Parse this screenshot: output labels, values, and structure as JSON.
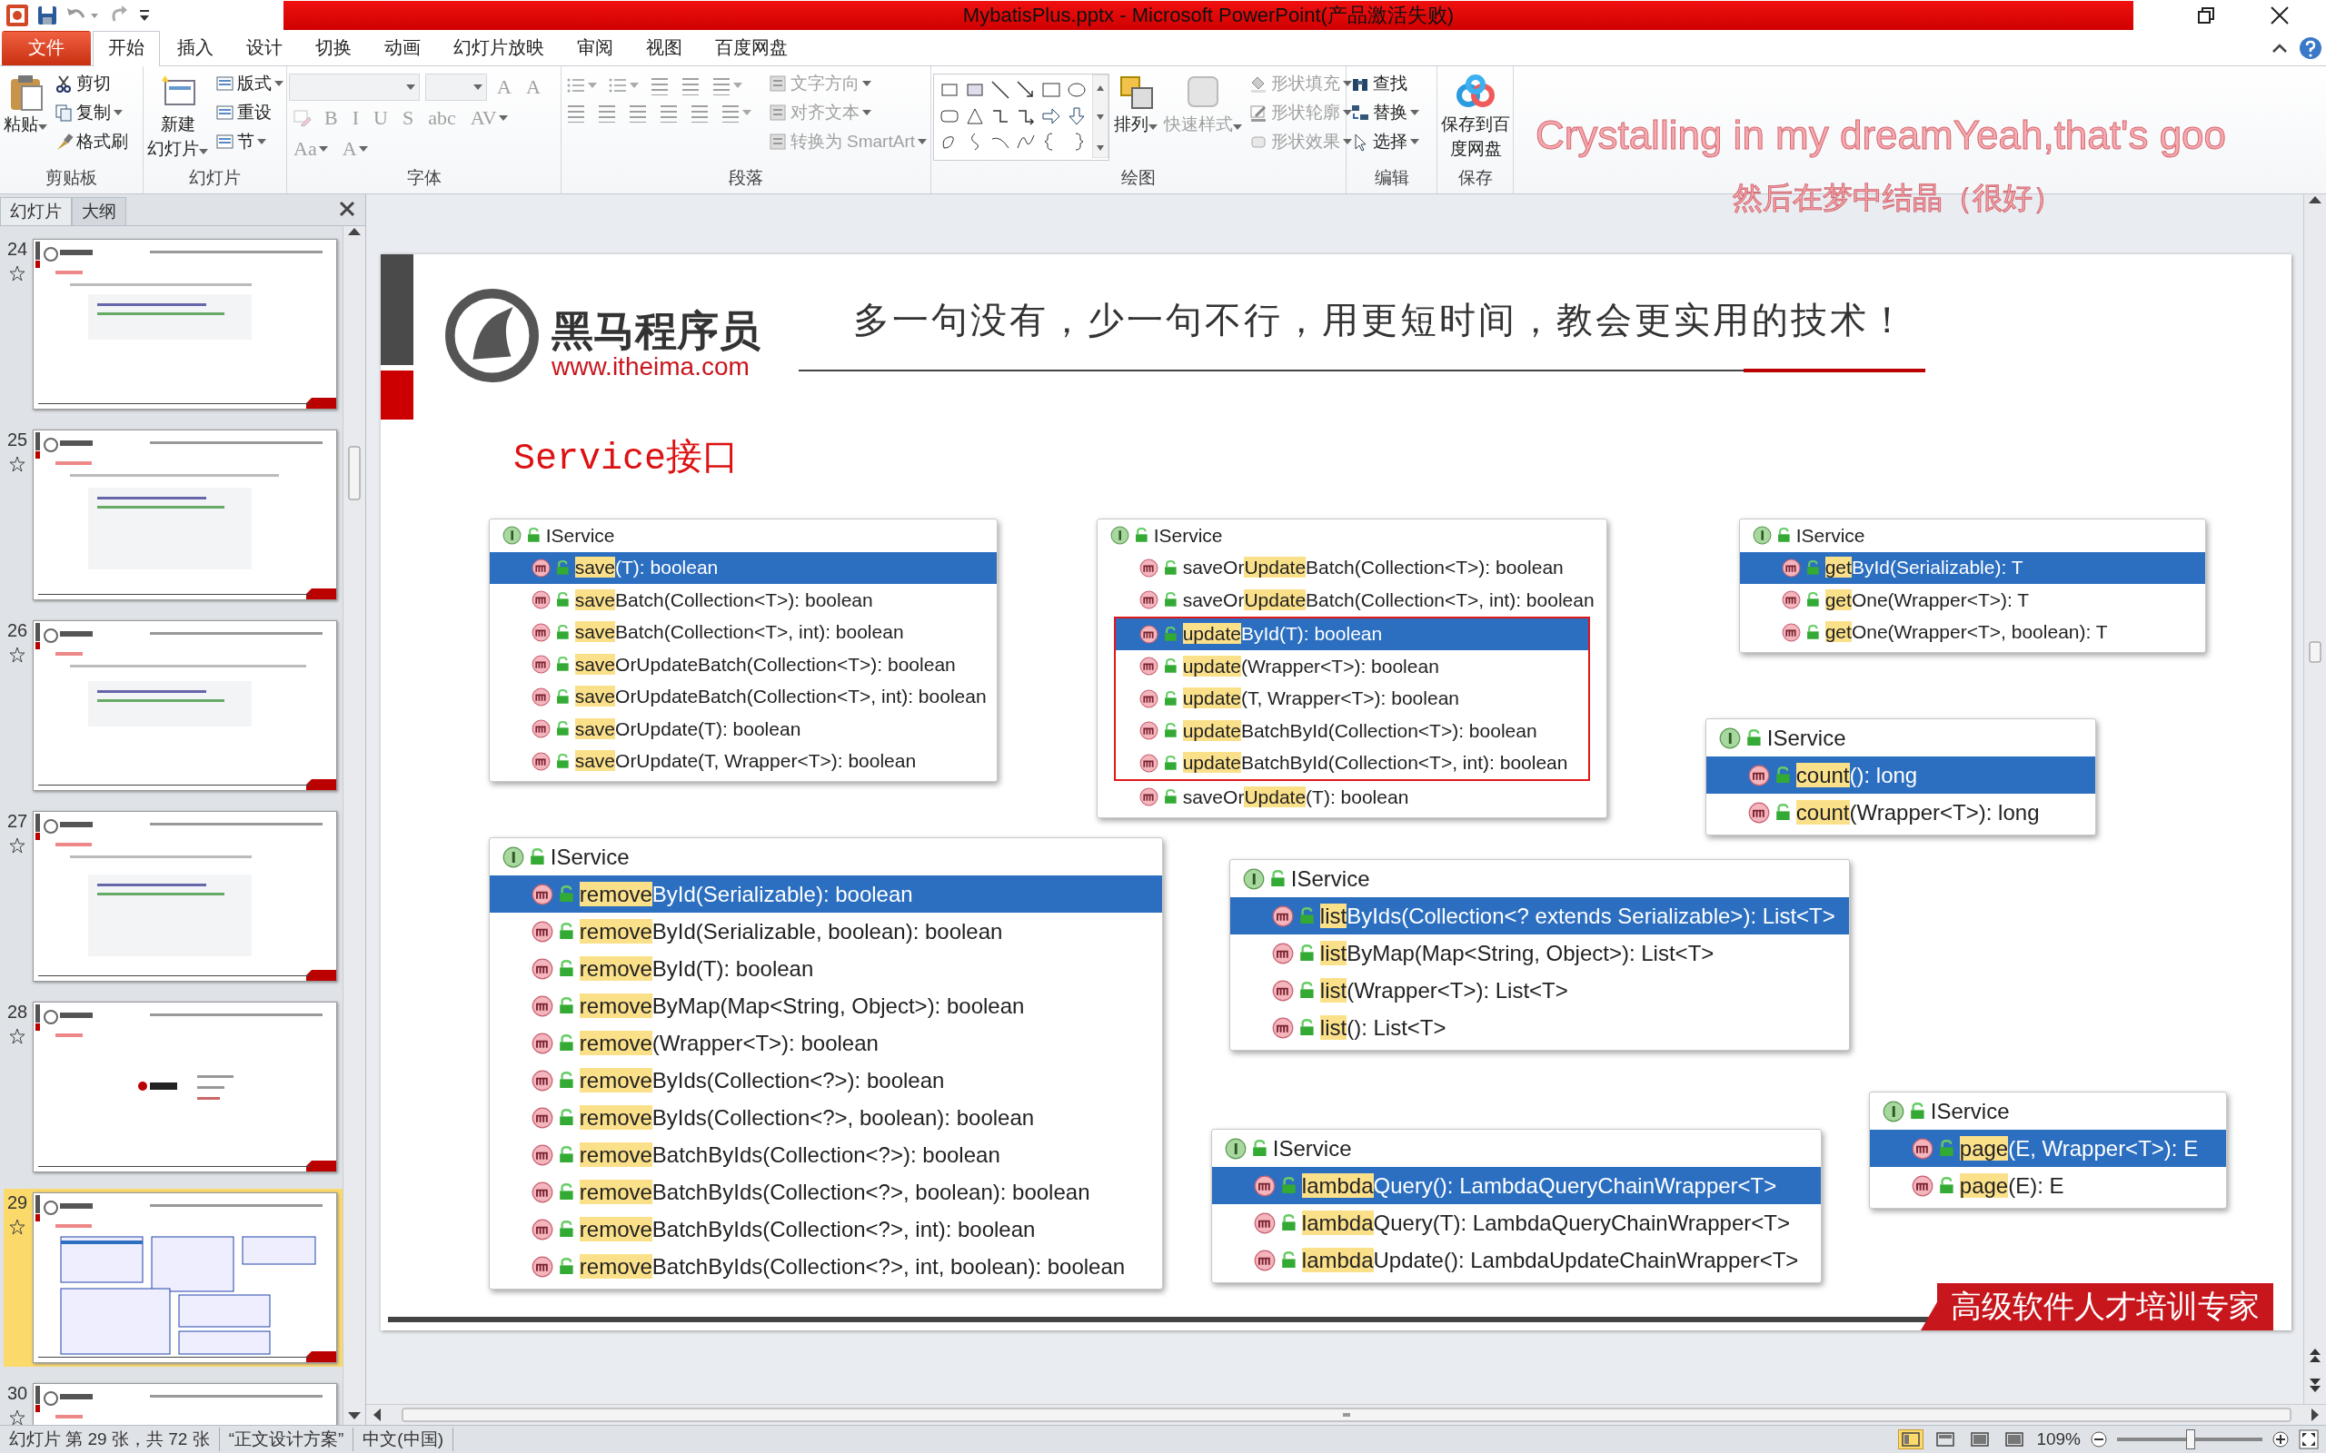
{
  "title_bar": {
    "title": "MybatisPlus.pptx - Microsoft PowerPoint(产品激活失败)"
  },
  "ribbon_tabs": [
    {
      "label": "文件",
      "kind": "file",
      "selected": false
    },
    {
      "label": "开始",
      "kind": "tab",
      "selected": true
    },
    {
      "label": "插入",
      "kind": "tab",
      "selected": false
    },
    {
      "label": "设计",
      "kind": "tab",
      "selected": false
    },
    {
      "label": "切换",
      "kind": "tab",
      "selected": false
    },
    {
      "label": "动画",
      "kind": "tab",
      "selected": false
    },
    {
      "label": "幻灯片放映",
      "kind": "tab",
      "selected": false
    },
    {
      "label": "审阅",
      "kind": "tab",
      "selected": false
    },
    {
      "label": "视图",
      "kind": "tab",
      "selected": false
    },
    {
      "label": "百度网盘",
      "kind": "tab",
      "selected": false
    }
  ],
  "ribbon_groups": [
    {
      "label": "剪贴板",
      "sections": [
        [
          {
            "kind": "large",
            "lines": [
              "粘贴"
            ],
            "dropdown": true,
            "disabled": false
          }
        ],
        [
          {
            "kind": "small",
            "label": "剪切",
            "dropdown": false,
            "disabled": false
          },
          {
            "kind": "small",
            "label": "复制",
            "dropdown": true,
            "disabled": false
          },
          {
            "kind": "small",
            "label": "格式刷",
            "dropdown": false,
            "disabled": false
          }
        ]
      ]
    },
    {
      "label": "幻灯片",
      "sections": [
        [
          {
            "kind": "large",
            "lines": [
              "新建",
              "幻灯片"
            ],
            "dropdown": true,
            "disabled": false
          }
        ],
        [
          {
            "kind": "small",
            "label": "版式",
            "dropdown": true,
            "disabled": false
          },
          {
            "kind": "small",
            "label": "重设",
            "dropdown": false,
            "disabled": false
          },
          {
            "kind": "small",
            "label": "节",
            "dropdown": true,
            "disabled": false
          }
        ]
      ]
    },
    {
      "label": "字体",
      "sections": [
        [
          {
            "kind": "combo",
            "dropdown": true,
            "disabled": true
          },
          {
            "kind": "combo",
            "dropdown": true,
            "disabled": true
          },
          {
            "kind": "letter",
            "label": "A",
            "dropdown": false,
            "disabled": true
          },
          {
            "kind": "letter",
            "label": "A",
            "dropdown": false,
            "disabled": true
          },
          {
            "kind": "icon",
            "dropdown": false,
            "disabled": true
          },
          {
            "kind": "letter",
            "label": "B",
            "dropdown": false,
            "disabled": true
          },
          {
            "kind": "letter",
            "label": "I",
            "dropdown": false,
            "disabled": true
          },
          {
            "kind": "letter",
            "label": "U",
            "dropdown": false,
            "disabled": true
          },
          {
            "kind": "letter",
            "label": "S",
            "dropdown": false,
            "disabled": true
          },
          {
            "kind": "letter",
            "label": "abc",
            "dropdown": false,
            "disabled": true
          },
          {
            "kind": "letter",
            "label": "AV",
            "dropdown": true,
            "disabled": true
          },
          {
            "kind": "letter",
            "label": "Aa",
            "dropdown": true,
            "disabled": true
          },
          {
            "kind": "letter",
            "label": "A",
            "dropdown": true,
            "disabled": true
          }
        ]
      ]
    },
    {
      "label": "段落",
      "sections": [
        [
          {
            "kind": "icon",
            "dropdown": true,
            "disabled": true
          },
          {
            "kind": "icon",
            "dropdown": true,
            "disabled": true
          },
          {
            "kind": "icon",
            "dropdown": false,
            "disabled": true
          },
          {
            "kind": "icon",
            "dropdown": false,
            "disabled": true
          },
          {
            "kind": "icon",
            "dropdown": true,
            "disabled": true
          },
          {
            "kind": "icon",
            "dropdown": false,
            "disabled": true
          },
          {
            "kind": "icon",
            "dropdown": false,
            "disabled": true
          },
          {
            "kind": "icon",
            "dropdown": false,
            "disabled": true
          },
          {
            "kind": "icon",
            "dropdown": false,
            "disabled": true
          },
          {
            "kind": "icon",
            "dropdown": false,
            "disabled": true
          },
          {
            "kind": "icon",
            "dropdown": true,
            "disabled": true
          }
        ],
        [
          {
            "kind": "small",
            "label": "文字方向",
            "dropdown": true,
            "disabled": true
          },
          {
            "kind": "small",
            "label": "对齐文本",
            "dropdown": true,
            "disabled": true
          },
          {
            "kind": "small",
            "label": "转换为 SmartArt",
            "dropdown": true,
            "disabled": true
          }
        ]
      ]
    },
    {
      "label": "绘图",
      "sections": [
        [
          {
            "kind": "gallery",
            "dropdown": false,
            "disabled": false
          }
        ],
        [
          {
            "kind": "large",
            "lines": [
              "排列"
            ],
            "dropdown": true,
            "disabled": false
          }
        ],
        [
          {
            "kind": "large",
            "lines": [
              "快速样式"
            ],
            "dropdown": true,
            "disabled": true
          }
        ],
        [
          {
            "kind": "small",
            "label": "形状填充",
            "dropdown": true,
            "disabled": true
          },
          {
            "kind": "small",
            "label": "形状轮廓",
            "dropdown": true,
            "disabled": true
          },
          {
            "kind": "small",
            "label": "形状效果",
            "dropdown": true,
            "disabled": true
          }
        ]
      ]
    },
    {
      "label": "编辑",
      "sections": [
        [
          {
            "kind": "small",
            "label": "查找",
            "dropdown": false,
            "disabled": false
          },
          {
            "kind": "small",
            "label": "替换",
            "dropdown": true,
            "disabled": false
          },
          {
            "kind": "small",
            "label": "选择",
            "dropdown": true,
            "disabled": false
          }
        ]
      ]
    },
    {
      "label": "保存",
      "sections": [
        [
          {
            "kind": "large",
            "lines": [
              "保存到百",
              "度网盘"
            ],
            "dropdown": false,
            "disabled": false
          }
        ]
      ]
    }
  ],
  "lyrics": {
    "line_1": "Crystalling in my dreamYeah,that's goo",
    "line_2": "然后在梦中结晶（很好）"
  },
  "slide_panel": {
    "tabs": [
      {
        "label": "幻灯片",
        "selected": true
      },
      {
        "label": "大纲",
        "selected": false
      }
    ],
    "slides": [
      {
        "number": "24",
        "selected": false
      },
      {
        "number": "25",
        "selected": false
      },
      {
        "number": "26",
        "selected": false
      },
      {
        "number": "27",
        "selected": false
      },
      {
        "number": "28",
        "selected": false
      },
      {
        "number": "29",
        "selected": true
      },
      {
        "number": "30",
        "selected": false
      }
    ]
  },
  "slide": {
    "brand": "黑马程序员",
    "website": "www.itheima.com",
    "slogan": "多一句没有，少一句不行，用更短时间，教会更实用的技术！",
    "heading": "Service接口",
    "footer_badge": "高级软件人才培训专家",
    "popups": [
      {
        "header": "IService",
        "items": [
          {
            "match": "save",
            "post": "(T): boolean",
            "selected": true,
            "boxed": false
          },
          {
            "match": "save",
            "post": "Batch(Collection<T>): boolean",
            "selected": false,
            "boxed": false
          },
          {
            "match": "save",
            "post": "Batch(Collection<T>, int): boolean",
            "selected": false,
            "boxed": false
          },
          {
            "match": "save",
            "post": "OrUpdateBatch(Collection<T>): boolean",
            "selected": false,
            "boxed": false
          },
          {
            "match": "save",
            "post": "OrUpdateBatch(Collection<T>, int): boolean",
            "selected": false,
            "boxed": false
          },
          {
            "match": "save",
            "post": "OrUpdate(T): boolean",
            "selected": false,
            "boxed": false
          },
          {
            "match": "save",
            "post": "OrUpdate(T, Wrapper<T>): boolean",
            "selected": false,
            "boxed": false
          }
        ]
      },
      {
        "header": "IService",
        "items": [
          {
            "pre": "saveOr",
            "match": "Update",
            "post": "Batch(Collection<T>): boolean",
            "selected": false,
            "boxed": false
          },
          {
            "pre": "saveOr",
            "match": "Update",
            "post": "Batch(Collection<T>, int): boolean",
            "selected": false,
            "boxed": false
          },
          {
            "match": "update",
            "post": "ById(T): boolean",
            "selected": true,
            "boxed": true
          },
          {
            "match": "update",
            "post": "(Wrapper<T>): boolean",
            "selected": false,
            "boxed": true
          },
          {
            "match": "update",
            "post": "(T, Wrapper<T>): boolean",
            "selected": false,
            "boxed": true
          },
          {
            "match": "update",
            "post": "BatchById(Collection<T>): boolean",
            "selected": false,
            "boxed": true
          },
          {
            "match": "update",
            "post": "BatchById(Collection<T>, int): boolean",
            "selected": false,
            "boxed": true
          },
          {
            "pre": "saveOr",
            "match": "Update",
            "post": "(T): boolean",
            "selected": false,
            "boxed": false
          }
        ]
      },
      {
        "header": "IService",
        "items": [
          {
            "match": "get",
            "post": "ById(Serializable): T",
            "selected": true,
            "boxed": false
          },
          {
            "match": "get",
            "post": "One(Wrapper<T>): T",
            "selected": false,
            "boxed": false
          },
          {
            "match": "get",
            "post": "One(Wrapper<T>, boolean): T",
            "selected": false,
            "boxed": false
          }
        ]
      },
      {
        "header": "IService",
        "items": [
          {
            "match": "count",
            "post": "(): long",
            "selected": true,
            "boxed": false
          },
          {
            "match": "count",
            "post": "(Wrapper<T>): long",
            "selected": false,
            "boxed": false
          }
        ]
      },
      {
        "header": "IService",
        "items": [
          {
            "match": "remove",
            "post": "ById(Serializable): boolean",
            "selected": true,
            "boxed": false
          },
          {
            "match": "remove",
            "post": "ById(Serializable, boolean): boolean",
            "selected": false,
            "boxed": false
          },
          {
            "match": "remove",
            "post": "ById(T): boolean",
            "selected": false,
            "boxed": false
          },
          {
            "match": "remove",
            "post": "ByMap(Map<String, Object>): boolean",
            "selected": false,
            "boxed": false
          },
          {
            "match": "remove",
            "post": "(Wrapper<T>): boolean",
            "selected": false,
            "boxed": false
          },
          {
            "match": "remove",
            "post": "ByIds(Collection<?>): boolean",
            "selected": false,
            "boxed": false
          },
          {
            "match": "remove",
            "post": "ByIds(Collection<?>, boolean): boolean",
            "selected": false,
            "boxed": false
          },
          {
            "match": "remove",
            "post": "BatchByIds(Collection<?>): boolean",
            "selected": false,
            "boxed": false
          },
          {
            "match": "remove",
            "post": "BatchByIds(Collection<?>, boolean): boolean",
            "selected": false,
            "boxed": false
          },
          {
            "match": "remove",
            "post": "BatchByIds(Collection<?>, int): boolean",
            "selected": false,
            "boxed": false
          },
          {
            "match": "remove",
            "post": "BatchByIds(Collection<?>, int, boolean): boolean",
            "selected": false,
            "boxed": false
          }
        ]
      },
      {
        "header": "IService",
        "items": [
          {
            "match": "list",
            "post": "ByIds(Collection<? extends Serializable>): List<T>",
            "selected": true,
            "boxed": false
          },
          {
            "match": "list",
            "post": "ByMap(Map<String, Object>): List<T>",
            "selected": false,
            "boxed": false
          },
          {
            "match": "list",
            "post": "(Wrapper<T>): List<T>",
            "selected": false,
            "boxed": false
          },
          {
            "match": "list",
            "post": "(): List<T>",
            "selected": false,
            "boxed": false
          }
        ]
      },
      {
        "header": "IService",
        "items": [
          {
            "match": "page",
            "post": "(E, Wrapper<T>): E",
            "selected": true,
            "boxed": false
          },
          {
            "match": "page",
            "post": "(E): E",
            "selected": false,
            "boxed": false
          }
        ]
      },
      {
        "header": "IService",
        "items": [
          {
            "match": "lambda",
            "post": "Query(): LambdaQueryChainWrapper<T>",
            "selected": true,
            "boxed": false
          },
          {
            "match": "lambda",
            "post": "Query(T): LambdaQueryChainWrapper<T>",
            "selected": false,
            "boxed": false
          },
          {
            "match": "lambda",
            "post": "Update(): LambdaUpdateChainWrapper<T>",
            "selected": false,
            "boxed": false
          }
        ]
      }
    ]
  },
  "status_bar": {
    "slide_info": "幻灯片 第 29 张，共 72 张",
    "theme": "“正文设计方案”",
    "language": "中文(中国)",
    "views": [
      {
        "selected": true
      },
      {
        "selected": false
      },
      {
        "selected": false
      },
      {
        "selected": false
      }
    ],
    "zoom": "109%",
    "zoom_slider": {
      "level": 0.5
    }
  }
}
